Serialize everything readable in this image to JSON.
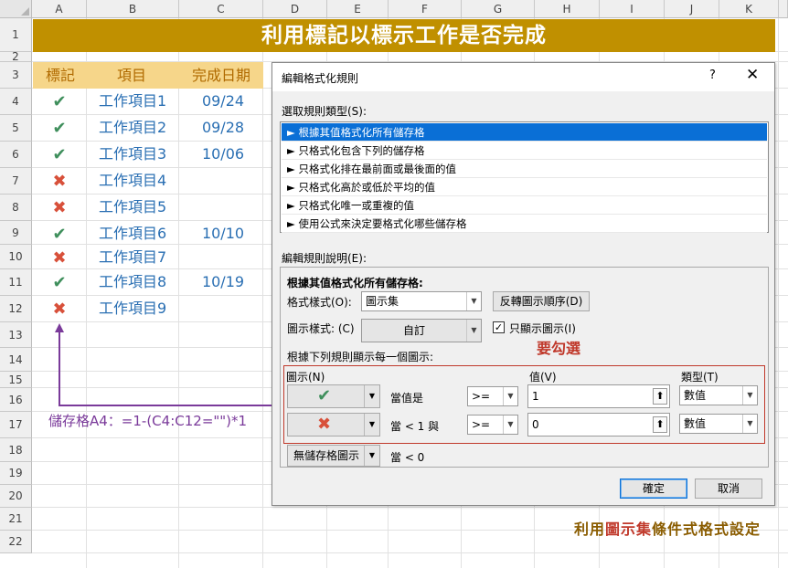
{
  "sheet": {
    "columns": [
      "A",
      "B",
      "C",
      "D",
      "E",
      "F",
      "G",
      "H",
      "I",
      "J",
      "K"
    ],
    "rows": [
      "1",
      "2",
      "3",
      "4",
      "5",
      "6",
      "7",
      "8",
      "9",
      "10",
      "11",
      "12",
      "13",
      "14",
      "15",
      "16",
      "17",
      "18",
      "19",
      "20",
      "21",
      "22"
    ],
    "title": "利用標記以標示工作是否完成",
    "header": {
      "mark": "標記",
      "item": "項目",
      "date": "完成日期"
    },
    "tasks": [
      {
        "mark": "✔",
        "item": "工作項目1",
        "date": "09/24"
      },
      {
        "mark": "✔",
        "item": "工作項目2",
        "date": "09/28"
      },
      {
        "mark": "✔",
        "item": "工作項目3",
        "date": "10/06"
      },
      {
        "mark": "✖",
        "item": "工作項目4",
        "date": ""
      },
      {
        "mark": "✖",
        "item": "工作項目5",
        "date": ""
      },
      {
        "mark": "✔",
        "item": "工作項目6",
        "date": "10/10"
      },
      {
        "mark": "✖",
        "item": "工作項目7",
        "date": ""
      },
      {
        "mark": "✔",
        "item": "工作項目8",
        "date": "10/19"
      },
      {
        "mark": "✖",
        "item": "工作項目9",
        "date": ""
      }
    ],
    "formula_note": "儲存格A4：=1-(C4:C12=\"\")*1",
    "caption_pre": "利用",
    "caption_hl": "圖示集",
    "caption_post": "條件式格式設定"
  },
  "dialog": {
    "title": "編輯格式化規則",
    "help": "?",
    "close": "✕",
    "select_type_label": "選取規則類型(S):",
    "rule_types": [
      "► 根據其值格式化所有儲存格",
      "► 只格式化包含下列的儲存格",
      "► 只格式化排在最前面或最後面的值",
      "► 只格式化高於或低於平均的值",
      "► 只格式化唯一或重複的值",
      "► 使用公式來決定要格式化哪些儲存格"
    ],
    "edit_desc_label": "編輯規則說明(E):",
    "desc_heading": "根據其值格式化所有儲存格:",
    "format_style_label": "格式樣式(O):",
    "format_style_value": "圖示集",
    "reverse_button": "反轉圖示順序(D)",
    "icon_style_label": "圖示樣式: (C)",
    "icon_style_value": "自訂",
    "show_icon_only_label": "只顯示圖示(I)",
    "show_icon_only_checked": "✓",
    "rules_heading": "根據下列規則顯示每一個圖示:",
    "col_icon": "圖示(N)",
    "col_value": "值(V)",
    "col_type": "類型(T)",
    "rule_rows": [
      {
        "icon": "✔",
        "icon_color": "#3f8f5c",
        "condition": "當值是",
        "operator": ">=",
        "value": "1",
        "type": "數值"
      },
      {
        "icon": "✖",
        "icon_color": "#d8503a",
        "condition": "當 < 1 與",
        "operator": ">=",
        "value": "0",
        "type": "數值"
      }
    ],
    "no_icon_button": "無儲存格圖示",
    "last_condition": "當 < 0",
    "ok_button": "確定",
    "cancel_button": "取消",
    "annotation": "要勾選"
  }
}
